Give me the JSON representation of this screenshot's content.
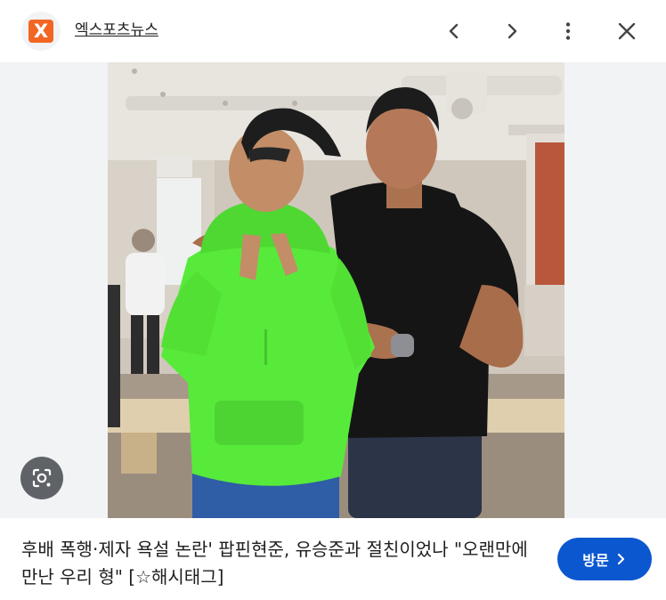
{
  "header": {
    "source_logo_letter": "X",
    "source_name": "엑스포츠뉴스",
    "icons": {
      "back": "chevron-left-icon",
      "forward": "chevron-right-icon",
      "more": "more-vert-icon",
      "close": "close-icon"
    }
  },
  "image": {
    "lens_icon": "google-lens-icon"
  },
  "caption": {
    "text": "후배 폭행·제자 욕설 논란' 팝핀현준, 유승준과 절친이었나 \"오랜만에 만난 우리 형\" [☆해시태그]"
  },
  "visit_button": {
    "label": "방문",
    "icon": "chevron-right-icon"
  },
  "colors": {
    "accent": "#0b57d0",
    "source_logo": "#f26522",
    "image_background": "#f1f3f4",
    "text": "#1f1f1f"
  }
}
